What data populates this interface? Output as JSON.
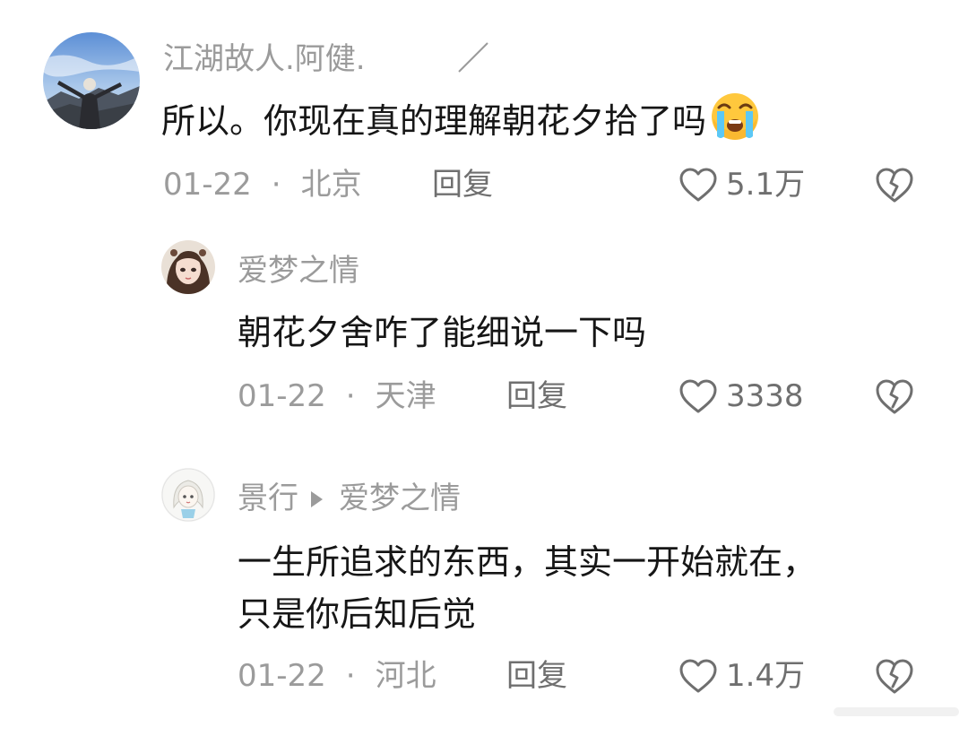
{
  "comments": [
    {
      "username": "江湖故人.阿健.",
      "text": "所以。你现在真的理解朝花夕拾了吗",
      "emoji": "loudly-crying-face-emoji",
      "date": "01-22",
      "separator": "·",
      "location": "北京",
      "reply_label": "回复",
      "likes": "5.1万",
      "avatar": "landscape-photo-avatar"
    },
    {
      "username": "爱梦之情",
      "text": "朝花夕舍咋了能细说一下吗",
      "date": "01-22",
      "separator": "·",
      "location": "天津",
      "reply_label": "回复",
      "likes": "3338",
      "avatar": "anime-girl-avatar"
    },
    {
      "username": "景行",
      "reply_to": "爱梦之情",
      "text_line1": "一生所追求的东西，其实一开始就在，",
      "text_line2": "只是你后知后觉",
      "date": "01-22",
      "separator": "·",
      "location": "河北",
      "reply_label": "回复",
      "likes": "1.4万",
      "avatar": "cartoon-girl-avatar"
    }
  ],
  "icons": {
    "like": "heart-outline-icon",
    "dislike": "broken-heart-icon"
  },
  "colors": {
    "text": "#161616",
    "meta": "#9b9b9b",
    "action": "#6f6f6f",
    "background": "#ffffff"
  }
}
